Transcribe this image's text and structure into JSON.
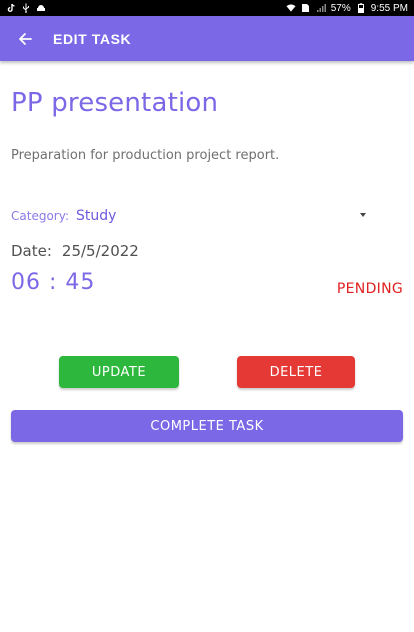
{
  "status_bar": {
    "battery": "57%",
    "time": "9:55 PM"
  },
  "app_bar": {
    "title": "EDIT TASK",
    "back_icon": "arrow-left-icon"
  },
  "task": {
    "title": "PP presentation",
    "description": "Preparation for production project report.",
    "category_label": "Category:",
    "category_value": "Study",
    "date_label": "Date:",
    "date_value": "25/5/2022",
    "time": "06 : 45",
    "status": "PENDING"
  },
  "buttons": {
    "update": "UPDATE",
    "delete": "DELETE",
    "complete": "COMPLETE TASK"
  },
  "colors": {
    "accent": "#7b68e6",
    "update": "#2db83d",
    "delete": "#e53935",
    "status_pending": "#e02020"
  }
}
